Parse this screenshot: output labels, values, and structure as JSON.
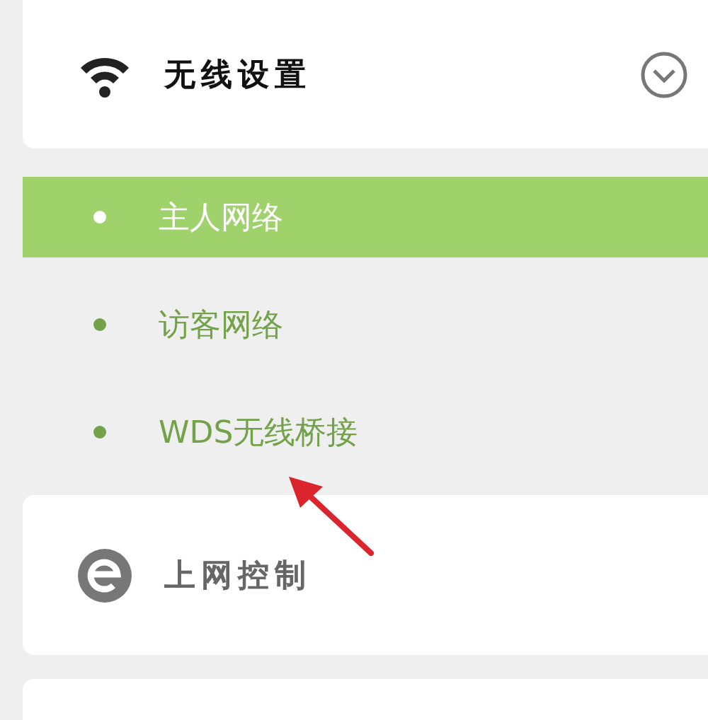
{
  "menu": [
    {
      "title": "无线设置",
      "expanded": true,
      "children": [
        {
          "label": "主人网络",
          "selected": true
        },
        {
          "label": "访客网络",
          "selected": false
        },
        {
          "label": "WDS无线桥接",
          "selected": false
        }
      ]
    },
    {
      "title": "上网控制"
    }
  ]
}
